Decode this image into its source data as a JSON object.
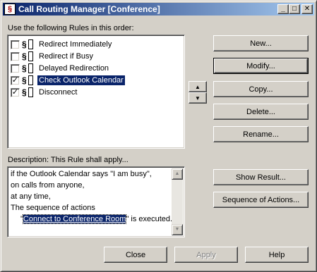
{
  "window": {
    "title": "Call Routing Manager [Conference]",
    "app_icon": "§",
    "minimize": "_",
    "maximize": "□",
    "close": "✕"
  },
  "rules": {
    "label": "Use the following Rules in this order:",
    "items": [
      {
        "label": "Redirect Immediately",
        "checked": false,
        "mark": "",
        "selected": false
      },
      {
        "label": "Redirect if Busy",
        "checked": false,
        "mark": "",
        "selected": false
      },
      {
        "label": "Delayed Redirection",
        "checked": false,
        "mark": "",
        "selected": false
      },
      {
        "label": "Check Outlook Calendar",
        "checked": true,
        "mark": "✓",
        "selected": true
      },
      {
        "label": "Disconnect",
        "checked": true,
        "mark": "✓",
        "selected": false
      }
    ]
  },
  "order": {
    "up_glyph": "▲",
    "down_glyph": "▼"
  },
  "buttons": {
    "new": "New...",
    "modify": "Modify...",
    "copy": "Copy...",
    "delete": "Delete...",
    "rename": "Rename...",
    "show_result": "Show Result...",
    "sequence": "Sequence of Actions...",
    "close": "Close",
    "apply": "Apply",
    "help": "Help"
  },
  "description": {
    "label": "Description: This Rule shall apply...",
    "lines": [
      "if the Outlook Calendar says \"I am busy\",",
      "on calls from anyone,",
      "at any time,",
      "The sequence of actions"
    ],
    "action_prefix": "\"",
    "action_link": "Connect to Conference Room",
    "action_suffix": "\" is executed."
  },
  "colors": {
    "face": "#d4d0c8",
    "title_start": "#0a246a",
    "title_end": "#a6caf0",
    "selection": "#0a246a"
  }
}
